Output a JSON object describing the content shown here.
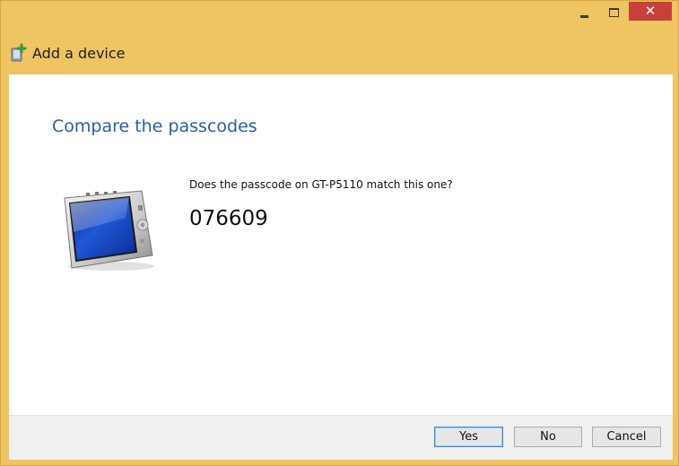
{
  "window": {
    "title": "Add a device",
    "controls": {
      "minimize_icon": "minimize-icon",
      "maximize_icon": "maximize-icon",
      "close_icon": "close-icon",
      "close_glyph": "✕"
    },
    "frame_color": "#efc462",
    "close_color": "#c7413a"
  },
  "content": {
    "heading": "Compare the passcodes",
    "heading_color": "#2b5ea3",
    "device_icon": "tablet-device-icon",
    "question": "Does the passcode on GT-P5110 match this one?",
    "passcode": "076609"
  },
  "buttons": {
    "yes": "Yes",
    "no": "No",
    "cancel": "Cancel"
  }
}
